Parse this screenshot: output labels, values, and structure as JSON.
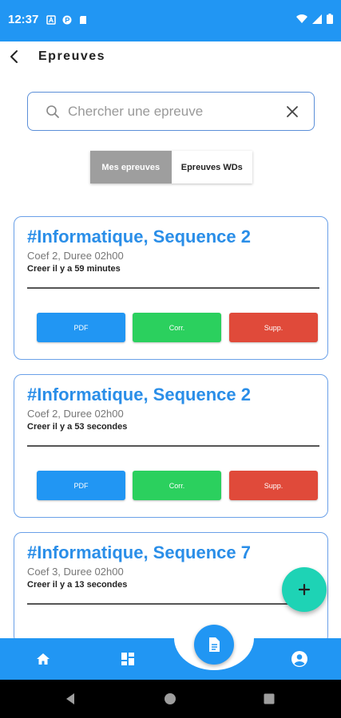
{
  "status_bar": {
    "time": "12:37"
  },
  "app_bar": {
    "title": "Epreuves"
  },
  "search": {
    "placeholder": "Chercher une epreuve",
    "value": ""
  },
  "segments": [
    {
      "label": "Mes epreuves",
      "active": true
    },
    {
      "label": "Epreuves WDs",
      "active": false
    }
  ],
  "cards": [
    {
      "title": "#Informatique, Sequence 2",
      "subtitle": "Coef 2, Duree 02h00",
      "created": "Creer il y a 59 minutes",
      "buttons": {
        "pdf": "PDF",
        "corr": "Corr.",
        "supp": "Supp."
      }
    },
    {
      "title": "#Informatique, Sequence 2",
      "subtitle": "Coef 2, Duree 02h00",
      "created": "Creer il y a 53 secondes",
      "buttons": {
        "pdf": "PDF",
        "corr": "Corr.",
        "supp": "Supp."
      }
    },
    {
      "title": "#Informatique, Sequence 7",
      "subtitle": "Coef 3, Duree 02h00",
      "created": "Creer il y a 13 secondes"
    }
  ],
  "colors": {
    "primary": "#2196f3",
    "pdf": "#2196f3",
    "corr": "#2bd05e",
    "supp": "#e04a3a",
    "fab": "#1ed3b5",
    "segment_active": "#9e9e9e"
  },
  "icons": [
    "back-arrow-icon",
    "search-icon",
    "close-icon",
    "add-icon",
    "home-icon",
    "dashboard-icon",
    "document-icon",
    "account-circle-icon"
  ]
}
